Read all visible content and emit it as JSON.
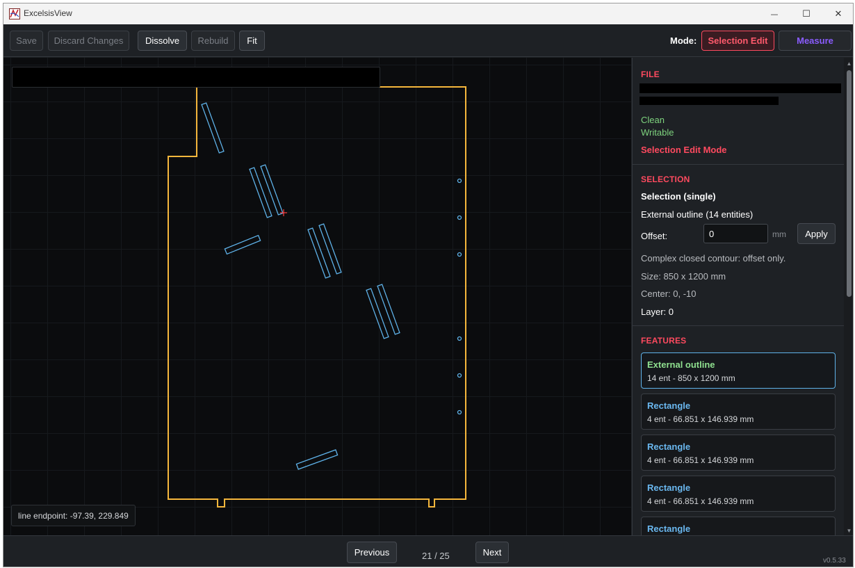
{
  "window": {
    "title": "ExcelsisView",
    "controls": {
      "minimize": "—",
      "maximize": "☐",
      "close": "✕"
    }
  },
  "toolbar": {
    "save_label": "Save",
    "discard_label": "Discard Changes",
    "dissolve_label": "Dissolve",
    "rebuild_label": "Rebuild",
    "fit_label": "Fit",
    "mode_label": "Mode:",
    "selection_edit_label": "Selection Edit",
    "measure_label": "Measure",
    "colors": {
      "selection_edit": "#ff4a5f",
      "measure": "#8a5cff"
    }
  },
  "canvas": {
    "coordinate_readout": "line endpoint: -97.39, 229.849",
    "colors": {
      "outline": "#f6b73c",
      "features": "#5fb3ea",
      "cursor": "#ff3b3b",
      "background": "#0b0c0e"
    }
  },
  "panel": {
    "file": {
      "title": "FILE",
      "status_clean": "Clean",
      "status_writable": "Writable",
      "mode_text": "Selection Edit Mode"
    },
    "selection": {
      "title": "SELECTION",
      "kind": "Selection (single)",
      "description": "External outline (14 entities)",
      "offset_label": "Offset:",
      "offset_value": "0",
      "offset_unit": "mm",
      "apply_label": "Apply",
      "note": "Complex closed contour: offset only.",
      "size": "Size: 850 x 1200 mm",
      "center": "Center: 0, -10",
      "layer": "Layer: 0"
    },
    "features": {
      "title": "FEATURES",
      "items": [
        {
          "name": "External outline",
          "detail": "14 ent - 850 x 1200 mm"
        },
        {
          "name": "Rectangle",
          "detail": "4 ent - 66.851 x 146.939 mm"
        },
        {
          "name": "Rectangle",
          "detail": "4 ent - 66.851 x 146.939 mm"
        },
        {
          "name": "Rectangle",
          "detail": "4 ent - 66.851 x 146.939 mm"
        },
        {
          "name": "Rectangle",
          "detail": ""
        }
      ]
    }
  },
  "footer": {
    "previous_label": "Previous",
    "page_indicator": "21 / 25",
    "next_label": "Next",
    "version": "v0.5.33"
  }
}
